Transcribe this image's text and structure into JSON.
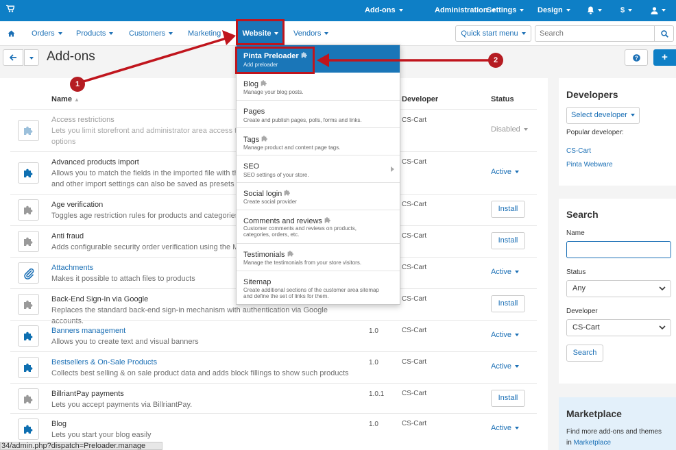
{
  "topbar": {
    "addons": "Add-ons",
    "administration": "Administration",
    "settings": "Settings",
    "design": "Design",
    "currency": "$"
  },
  "navbar": {
    "orders": "Orders",
    "products": "Products",
    "customers": "Customers",
    "marketing": "Marketing",
    "website": "Website",
    "vendors": "Vendors",
    "quick_start": "Quick start menu",
    "search_placeholder": "Search"
  },
  "page": {
    "title": "Add-ons"
  },
  "table": {
    "headers": {
      "name": "Name",
      "developer": "Developer",
      "status": "Status"
    },
    "rows": [
      {
        "name": "Access restrictions",
        "desc": "Lets you limit storefront and administrator area access to",
        "desc2": "options",
        "version": "",
        "developer": "CS-Cart",
        "status": "Disabled",
        "icon": "puzzle-icon"
      },
      {
        "name": "Advanced products import",
        "desc": "Allows you to match the fields in the imported file with the",
        "desc2": "and other import settings can also be saved as presets fo",
        "version": "",
        "developer": "CS-Cart",
        "status": "Active",
        "icon": "puzzle-icon"
      },
      {
        "name": "Age verification",
        "desc": "Toggles age restriction rules for products and categories",
        "version": "",
        "developer": "CS-Cart",
        "status": "Install",
        "icon": "puzzle-icon"
      },
      {
        "name": "Anti fraud",
        "desc": "Adds configurable security order verification using the Ma",
        "version": "",
        "developer": "CS-Cart",
        "status": "Install",
        "icon": "puzzle-icon"
      },
      {
        "name": "Attachments",
        "desc": "Makes it possible to attach files to products",
        "version": "",
        "developer": "CS-Cart",
        "status": "Active",
        "icon": "paperclip-icon"
      },
      {
        "name": "Back-End Sign-In via Google",
        "desc": "Replaces the standard back-end sign-in mechanism with authentication via Google accounts.",
        "version": "",
        "developer": "CS-Cart",
        "status": "Install",
        "icon": "puzzle-icon"
      },
      {
        "name": "Banners management",
        "desc": "Allows you to create text and visual banners",
        "version": "1.0",
        "developer": "CS-Cart",
        "status": "Active",
        "icon": "puzzle-icon"
      },
      {
        "name": "Bestsellers & On-Sale Products",
        "desc": "Collects best selling & on sale product data and adds block fillings to show such products",
        "version": "1.0",
        "developer": "CS-Cart",
        "status": "Active",
        "icon": "puzzle-icon"
      },
      {
        "name": "BillriantPay payments",
        "desc": "Lets you accept payments via BillriantPay.",
        "version": "1.0.1",
        "developer": "CS-Cart",
        "status": "Install",
        "icon": "puzzle-icon"
      },
      {
        "name": "Blog",
        "desc": "Lets you start your blog easily",
        "version": "1.0",
        "developer": "CS-Cart",
        "status": "Active",
        "icon": "puzzle-icon"
      }
    ]
  },
  "dropdown": {
    "items": [
      {
        "title": "Pinta Preloader",
        "desc": "Add preloader"
      },
      {
        "title": "Blog",
        "desc": "Manage your blog posts."
      },
      {
        "title": "Pages",
        "desc": "Create and publish pages, polls, forms and links."
      },
      {
        "title": "Tags",
        "desc": "Manage product and content page tags."
      },
      {
        "title": "SEO",
        "desc": "SEO settings of your store."
      },
      {
        "title": "Social login",
        "desc": "Create social provider"
      },
      {
        "title": "Comments and reviews",
        "desc": "Customer comments and reviews on products, categories, orders, etc."
      },
      {
        "title": "Testimonials",
        "desc": "Manage the testimonials from your store visitors."
      },
      {
        "title": "Sitemap",
        "desc": "Create additional sections of the customer area sitemap and define the set of links for them."
      }
    ]
  },
  "developers": {
    "title": "Developers",
    "select_btn": "Select developer",
    "popular": "Popular developer:",
    "dev1": "CS-Cart",
    "dev2": "Pinta Webware"
  },
  "search": {
    "title": "Search",
    "name_label": "Name",
    "status_label": "Status",
    "status_value": "Any",
    "developer_label": "Developer",
    "developer_value": "CS-Cart",
    "button": "Search"
  },
  "marketplace": {
    "title": "Marketplace",
    "text": "Find more add-ons and themes",
    "text2": "in",
    "link": "Marketplace"
  },
  "annotations": {
    "one": "1",
    "two": "2"
  },
  "status_url": "34/admin.php?dispatch=Preloader.manage",
  "colors": {
    "topbar": "#0e7fc6",
    "link": "#1a6fb5",
    "highlight": "#c0151d",
    "dropdown_active": "#1a76b8"
  }
}
